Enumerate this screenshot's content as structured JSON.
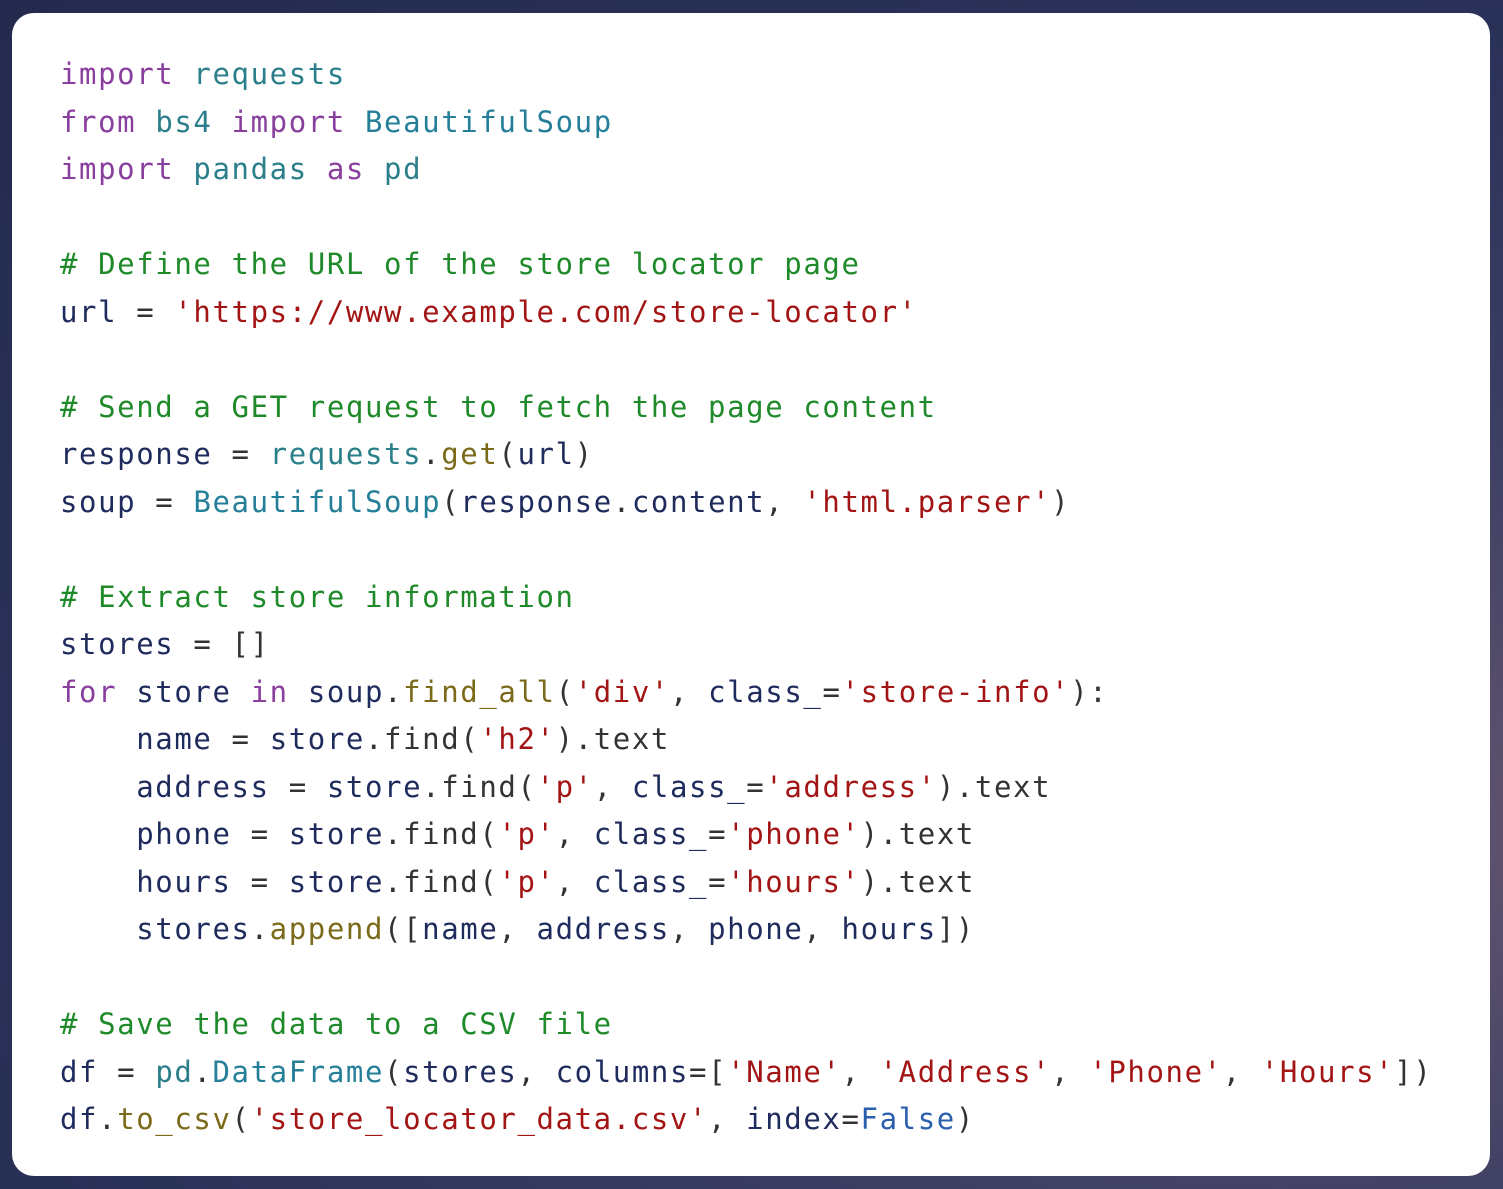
{
  "code_lines": [
    [
      {
        "t": "import",
        "k": "kw"
      },
      {
        "t": " ",
        "k": "op"
      },
      {
        "t": "requests",
        "k": "mod"
      }
    ],
    [
      {
        "t": "from",
        "k": "kw"
      },
      {
        "t": " ",
        "k": "op"
      },
      {
        "t": "bs4",
        "k": "mod"
      },
      {
        "t": " ",
        "k": "op"
      },
      {
        "t": "import",
        "k": "kw"
      },
      {
        "t": " ",
        "k": "op"
      },
      {
        "t": "BeautifulSoup",
        "k": "cls"
      }
    ],
    [
      {
        "t": "import",
        "k": "kw"
      },
      {
        "t": " ",
        "k": "op"
      },
      {
        "t": "pandas",
        "k": "mod"
      },
      {
        "t": " ",
        "k": "op"
      },
      {
        "t": "as",
        "k": "kw"
      },
      {
        "t": " ",
        "k": "op"
      },
      {
        "t": "pd",
        "k": "mod"
      }
    ],
    [],
    [
      {
        "t": "# Define the URL of the store locator page",
        "k": "cm"
      }
    ],
    [
      {
        "t": "url",
        "k": "var"
      },
      {
        "t": " = ",
        "k": "op"
      },
      {
        "t": "'https://www.example.com/store-locator'",
        "k": "str"
      }
    ],
    [],
    [
      {
        "t": "# Send a GET request to fetch the page content",
        "k": "cm"
      }
    ],
    [
      {
        "t": "response",
        "k": "var"
      },
      {
        "t": " = ",
        "k": "op"
      },
      {
        "t": "requests",
        "k": "mod"
      },
      {
        "t": ".",
        "k": "op"
      },
      {
        "t": "get",
        "k": "fn"
      },
      {
        "t": "(",
        "k": "op"
      },
      {
        "t": "url",
        "k": "var"
      },
      {
        "t": ")",
        "k": "op"
      }
    ],
    [
      {
        "t": "soup",
        "k": "var"
      },
      {
        "t": " = ",
        "k": "op"
      },
      {
        "t": "BeautifulSoup",
        "k": "cls"
      },
      {
        "t": "(",
        "k": "op"
      },
      {
        "t": "response",
        "k": "var"
      },
      {
        "t": ".",
        "k": "op"
      },
      {
        "t": "content",
        "k": "var"
      },
      {
        "t": ", ",
        "k": "op"
      },
      {
        "t": "'html.parser'",
        "k": "str"
      },
      {
        "t": ")",
        "k": "op"
      }
    ],
    [],
    [
      {
        "t": "# Extract store information",
        "k": "cm"
      }
    ],
    [
      {
        "t": "stores",
        "k": "var"
      },
      {
        "t": " = []",
        "k": "op"
      }
    ],
    [
      {
        "t": "for",
        "k": "kw"
      },
      {
        "t": " ",
        "k": "op"
      },
      {
        "t": "store",
        "k": "var"
      },
      {
        "t": " ",
        "k": "op"
      },
      {
        "t": "in",
        "k": "kw"
      },
      {
        "t": " ",
        "k": "op"
      },
      {
        "t": "soup",
        "k": "var"
      },
      {
        "t": ".",
        "k": "op"
      },
      {
        "t": "find_all",
        "k": "fn"
      },
      {
        "t": "(",
        "k": "op"
      },
      {
        "t": "'div'",
        "k": "str"
      },
      {
        "t": ", ",
        "k": "op"
      },
      {
        "t": "class_",
        "k": "var"
      },
      {
        "t": "=",
        "k": "op"
      },
      {
        "t": "'store-info'",
        "k": "str"
      },
      {
        "t": "):",
        "k": "op"
      }
    ],
    [
      {
        "t": "    ",
        "k": "op"
      },
      {
        "t": "name",
        "k": "var"
      },
      {
        "t": " = ",
        "k": "op"
      },
      {
        "t": "store",
        "k": "var"
      },
      {
        "t": ".find(",
        "k": "op"
      },
      {
        "t": "'h2'",
        "k": "str"
      },
      {
        "t": ").text",
        "k": "op"
      }
    ],
    [
      {
        "t": "    ",
        "k": "op"
      },
      {
        "t": "address",
        "k": "var"
      },
      {
        "t": " = ",
        "k": "op"
      },
      {
        "t": "store",
        "k": "var"
      },
      {
        "t": ".find(",
        "k": "op"
      },
      {
        "t": "'p'",
        "k": "str"
      },
      {
        "t": ", ",
        "k": "op"
      },
      {
        "t": "class_",
        "k": "var"
      },
      {
        "t": "=",
        "k": "op"
      },
      {
        "t": "'address'",
        "k": "str"
      },
      {
        "t": ").text",
        "k": "op"
      }
    ],
    [
      {
        "t": "    ",
        "k": "op"
      },
      {
        "t": "phone",
        "k": "var"
      },
      {
        "t": " = ",
        "k": "op"
      },
      {
        "t": "store",
        "k": "var"
      },
      {
        "t": ".find(",
        "k": "op"
      },
      {
        "t": "'p'",
        "k": "str"
      },
      {
        "t": ", ",
        "k": "op"
      },
      {
        "t": "class_",
        "k": "var"
      },
      {
        "t": "=",
        "k": "op"
      },
      {
        "t": "'phone'",
        "k": "str"
      },
      {
        "t": ").text",
        "k": "op"
      }
    ],
    [
      {
        "t": "    ",
        "k": "op"
      },
      {
        "t": "hours",
        "k": "var"
      },
      {
        "t": " = ",
        "k": "op"
      },
      {
        "t": "store",
        "k": "var"
      },
      {
        "t": ".find(",
        "k": "op"
      },
      {
        "t": "'p'",
        "k": "str"
      },
      {
        "t": ", ",
        "k": "op"
      },
      {
        "t": "class_",
        "k": "var"
      },
      {
        "t": "=",
        "k": "op"
      },
      {
        "t": "'hours'",
        "k": "str"
      },
      {
        "t": ").text",
        "k": "op"
      }
    ],
    [
      {
        "t": "    ",
        "k": "op"
      },
      {
        "t": "stores",
        "k": "var"
      },
      {
        "t": ".",
        "k": "op"
      },
      {
        "t": "append",
        "k": "fn"
      },
      {
        "t": "([",
        "k": "op"
      },
      {
        "t": "name",
        "k": "var"
      },
      {
        "t": ", ",
        "k": "op"
      },
      {
        "t": "address",
        "k": "var"
      },
      {
        "t": ", ",
        "k": "op"
      },
      {
        "t": "phone",
        "k": "var"
      },
      {
        "t": ", ",
        "k": "op"
      },
      {
        "t": "hours",
        "k": "var"
      },
      {
        "t": "])",
        "k": "op"
      }
    ],
    [],
    [
      {
        "t": "# Save the data to a CSV file",
        "k": "cm"
      }
    ],
    [
      {
        "t": "df",
        "k": "var"
      },
      {
        "t": " = ",
        "k": "op"
      },
      {
        "t": "pd",
        "k": "mod"
      },
      {
        "t": ".",
        "k": "op"
      },
      {
        "t": "DataFrame",
        "k": "cls"
      },
      {
        "t": "(",
        "k": "op"
      },
      {
        "t": "stores",
        "k": "var"
      },
      {
        "t": ", ",
        "k": "op"
      },
      {
        "t": "columns",
        "k": "var"
      },
      {
        "t": "=[",
        "k": "op"
      },
      {
        "t": "'Name'",
        "k": "str"
      },
      {
        "t": ", ",
        "k": "op"
      },
      {
        "t": "'Address'",
        "k": "str"
      },
      {
        "t": ", ",
        "k": "op"
      },
      {
        "t": "'Phone'",
        "k": "str"
      },
      {
        "t": ", ",
        "k": "op"
      },
      {
        "t": "'Hours'",
        "k": "str"
      },
      {
        "t": "])",
        "k": "op"
      }
    ],
    [
      {
        "t": "df",
        "k": "var"
      },
      {
        "t": ".",
        "k": "op"
      },
      {
        "t": "to_csv",
        "k": "fn"
      },
      {
        "t": "(",
        "k": "op"
      },
      {
        "t": "'store_locator_data.csv'",
        "k": "str"
      },
      {
        "t": ", ",
        "k": "op"
      },
      {
        "t": "index",
        "k": "var"
      },
      {
        "t": "=",
        "k": "op"
      },
      {
        "t": "False",
        "k": "bool"
      },
      {
        "t": ")",
        "k": "op"
      }
    ]
  ],
  "colors": {
    "keyword": "#8a3f9e",
    "module": "#2a7f8a",
    "class": "#267f99",
    "comment": "#1f8a2a",
    "string": "#a31515",
    "function": "#7a6a1a",
    "variable": "#1f2b5c",
    "boolean": "#2a5fae",
    "card_background": "#ffffff"
  }
}
